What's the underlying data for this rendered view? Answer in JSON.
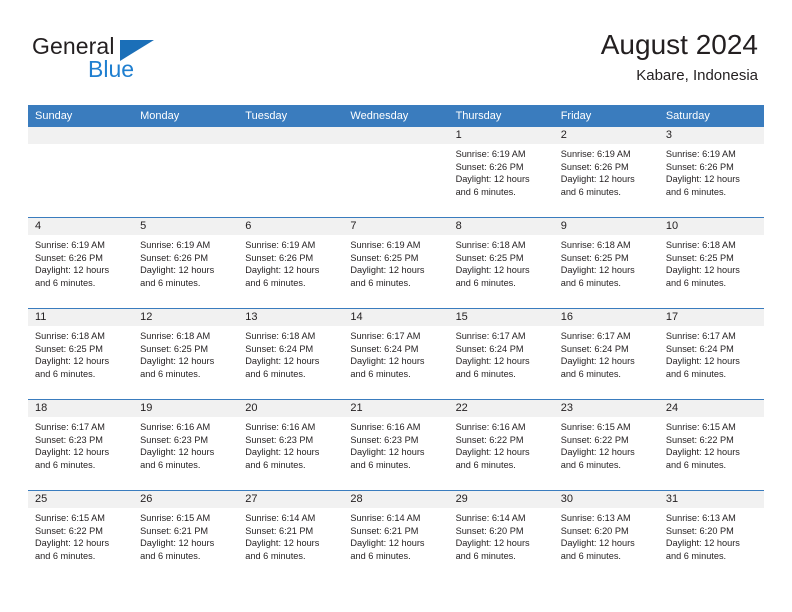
{
  "brand": {
    "name_part1": "General",
    "name_part2": "Blue",
    "color_dark": "#231f20",
    "color_blue": "#1f7fd0",
    "triangle_color": "#1b6fb8"
  },
  "header": {
    "title": "August 2024",
    "subtitle": "Kabare, Indonesia",
    "accent_color": "#3a7cbe"
  },
  "weekday_headers": [
    "Sunday",
    "Monday",
    "Tuesday",
    "Wednesday",
    "Thursday",
    "Friday",
    "Saturday"
  ],
  "weeks": [
    [
      {
        "day": "",
        "sunrise": "",
        "sunset": "",
        "daylight1": "",
        "daylight2": ""
      },
      {
        "day": "",
        "sunrise": "",
        "sunset": "",
        "daylight1": "",
        "daylight2": ""
      },
      {
        "day": "",
        "sunrise": "",
        "sunset": "",
        "daylight1": "",
        "daylight2": ""
      },
      {
        "day": "",
        "sunrise": "",
        "sunset": "",
        "daylight1": "",
        "daylight2": ""
      },
      {
        "day": "1",
        "sunrise": "Sunrise: 6:19 AM",
        "sunset": "Sunset: 6:26 PM",
        "daylight1": "Daylight: 12 hours",
        "daylight2": "and 6 minutes."
      },
      {
        "day": "2",
        "sunrise": "Sunrise: 6:19 AM",
        "sunset": "Sunset: 6:26 PM",
        "daylight1": "Daylight: 12 hours",
        "daylight2": "and 6 minutes."
      },
      {
        "day": "3",
        "sunrise": "Sunrise: 6:19 AM",
        "sunset": "Sunset: 6:26 PM",
        "daylight1": "Daylight: 12 hours",
        "daylight2": "and 6 minutes."
      }
    ],
    [
      {
        "day": "4",
        "sunrise": "Sunrise: 6:19 AM",
        "sunset": "Sunset: 6:26 PM",
        "daylight1": "Daylight: 12 hours",
        "daylight2": "and 6 minutes."
      },
      {
        "day": "5",
        "sunrise": "Sunrise: 6:19 AM",
        "sunset": "Sunset: 6:26 PM",
        "daylight1": "Daylight: 12 hours",
        "daylight2": "and 6 minutes."
      },
      {
        "day": "6",
        "sunrise": "Sunrise: 6:19 AM",
        "sunset": "Sunset: 6:26 PM",
        "daylight1": "Daylight: 12 hours",
        "daylight2": "and 6 minutes."
      },
      {
        "day": "7",
        "sunrise": "Sunrise: 6:19 AM",
        "sunset": "Sunset: 6:25 PM",
        "daylight1": "Daylight: 12 hours",
        "daylight2": "and 6 minutes."
      },
      {
        "day": "8",
        "sunrise": "Sunrise: 6:18 AM",
        "sunset": "Sunset: 6:25 PM",
        "daylight1": "Daylight: 12 hours",
        "daylight2": "and 6 minutes."
      },
      {
        "day": "9",
        "sunrise": "Sunrise: 6:18 AM",
        "sunset": "Sunset: 6:25 PM",
        "daylight1": "Daylight: 12 hours",
        "daylight2": "and 6 minutes."
      },
      {
        "day": "10",
        "sunrise": "Sunrise: 6:18 AM",
        "sunset": "Sunset: 6:25 PM",
        "daylight1": "Daylight: 12 hours",
        "daylight2": "and 6 minutes."
      }
    ],
    [
      {
        "day": "11",
        "sunrise": "Sunrise: 6:18 AM",
        "sunset": "Sunset: 6:25 PM",
        "daylight1": "Daylight: 12 hours",
        "daylight2": "and 6 minutes."
      },
      {
        "day": "12",
        "sunrise": "Sunrise: 6:18 AM",
        "sunset": "Sunset: 6:25 PM",
        "daylight1": "Daylight: 12 hours",
        "daylight2": "and 6 minutes."
      },
      {
        "day": "13",
        "sunrise": "Sunrise: 6:18 AM",
        "sunset": "Sunset: 6:24 PM",
        "daylight1": "Daylight: 12 hours",
        "daylight2": "and 6 minutes."
      },
      {
        "day": "14",
        "sunrise": "Sunrise: 6:17 AM",
        "sunset": "Sunset: 6:24 PM",
        "daylight1": "Daylight: 12 hours",
        "daylight2": "and 6 minutes."
      },
      {
        "day": "15",
        "sunrise": "Sunrise: 6:17 AM",
        "sunset": "Sunset: 6:24 PM",
        "daylight1": "Daylight: 12 hours",
        "daylight2": "and 6 minutes."
      },
      {
        "day": "16",
        "sunrise": "Sunrise: 6:17 AM",
        "sunset": "Sunset: 6:24 PM",
        "daylight1": "Daylight: 12 hours",
        "daylight2": "and 6 minutes."
      },
      {
        "day": "17",
        "sunrise": "Sunrise: 6:17 AM",
        "sunset": "Sunset: 6:24 PM",
        "daylight1": "Daylight: 12 hours",
        "daylight2": "and 6 minutes."
      }
    ],
    [
      {
        "day": "18",
        "sunrise": "Sunrise: 6:17 AM",
        "sunset": "Sunset: 6:23 PM",
        "daylight1": "Daylight: 12 hours",
        "daylight2": "and 6 minutes."
      },
      {
        "day": "19",
        "sunrise": "Sunrise: 6:16 AM",
        "sunset": "Sunset: 6:23 PM",
        "daylight1": "Daylight: 12 hours",
        "daylight2": "and 6 minutes."
      },
      {
        "day": "20",
        "sunrise": "Sunrise: 6:16 AM",
        "sunset": "Sunset: 6:23 PM",
        "daylight1": "Daylight: 12 hours",
        "daylight2": "and 6 minutes."
      },
      {
        "day": "21",
        "sunrise": "Sunrise: 6:16 AM",
        "sunset": "Sunset: 6:23 PM",
        "daylight1": "Daylight: 12 hours",
        "daylight2": "and 6 minutes."
      },
      {
        "day": "22",
        "sunrise": "Sunrise: 6:16 AM",
        "sunset": "Sunset: 6:22 PM",
        "daylight1": "Daylight: 12 hours",
        "daylight2": "and 6 minutes."
      },
      {
        "day": "23",
        "sunrise": "Sunrise: 6:15 AM",
        "sunset": "Sunset: 6:22 PM",
        "daylight1": "Daylight: 12 hours",
        "daylight2": "and 6 minutes."
      },
      {
        "day": "24",
        "sunrise": "Sunrise: 6:15 AM",
        "sunset": "Sunset: 6:22 PM",
        "daylight1": "Daylight: 12 hours",
        "daylight2": "and 6 minutes."
      }
    ],
    [
      {
        "day": "25",
        "sunrise": "Sunrise: 6:15 AM",
        "sunset": "Sunset: 6:22 PM",
        "daylight1": "Daylight: 12 hours",
        "daylight2": "and 6 minutes."
      },
      {
        "day": "26",
        "sunrise": "Sunrise: 6:15 AM",
        "sunset": "Sunset: 6:21 PM",
        "daylight1": "Daylight: 12 hours",
        "daylight2": "and 6 minutes."
      },
      {
        "day": "27",
        "sunrise": "Sunrise: 6:14 AM",
        "sunset": "Sunset: 6:21 PM",
        "daylight1": "Daylight: 12 hours",
        "daylight2": "and 6 minutes."
      },
      {
        "day": "28",
        "sunrise": "Sunrise: 6:14 AM",
        "sunset": "Sunset: 6:21 PM",
        "daylight1": "Daylight: 12 hours",
        "daylight2": "and 6 minutes."
      },
      {
        "day": "29",
        "sunrise": "Sunrise: 6:14 AM",
        "sunset": "Sunset: 6:20 PM",
        "daylight1": "Daylight: 12 hours",
        "daylight2": "and 6 minutes."
      },
      {
        "day": "30",
        "sunrise": "Sunrise: 6:13 AM",
        "sunset": "Sunset: 6:20 PM",
        "daylight1": "Daylight: 12 hours",
        "daylight2": "and 6 minutes."
      },
      {
        "day": "31",
        "sunrise": "Sunrise: 6:13 AM",
        "sunset": "Sunset: 6:20 PM",
        "daylight1": "Daylight: 12 hours",
        "daylight2": "and 6 minutes."
      }
    ]
  ]
}
